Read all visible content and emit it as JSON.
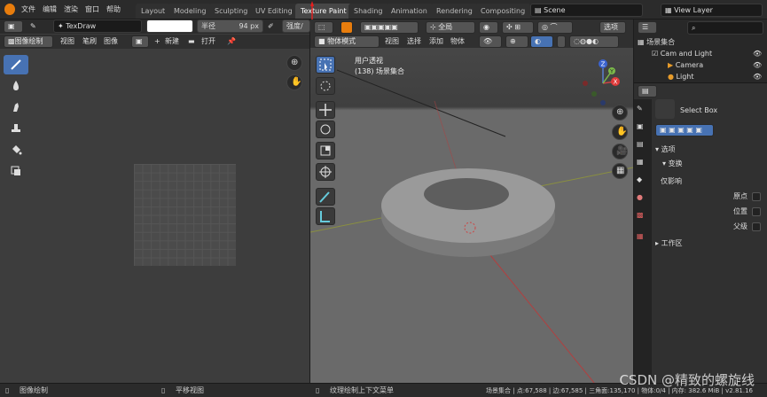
{
  "menu": [
    "文件",
    "编辑",
    "渲染",
    "窗口",
    "帮助"
  ],
  "workspaces": [
    "Layout",
    "Modeling",
    "Sculpting",
    "UV Editing",
    "Texture Paint",
    "Shading",
    "Animation",
    "Rendering",
    "Compositing"
  ],
  "active_workspace": "Texture Paint",
  "scene": "Scene",
  "view_layer": "View Layer",
  "brush": {
    "name": "TexDraw",
    "radius_label": "半径",
    "radius_value": "94 px",
    "strength_label": "强度/力"
  },
  "image_editor": {
    "mode": "图像绘制",
    "menu": [
      "视图",
      "笔刷",
      "图像"
    ],
    "new_label": "新建",
    "open_label": "打开"
  },
  "viewport": {
    "mode": "物体模式",
    "menu": [
      "视图",
      "选择",
      "添加",
      "物体"
    ],
    "orientation": "全局",
    "options": "选项",
    "overlay_title": "用户透视",
    "overlay_sub": "(138) 场景集合",
    "axis_x": "X",
    "axis_y": "Y",
    "axis_z": "Z"
  },
  "outliner": {
    "root": "场景集合",
    "collection": "Cam and Light",
    "items": [
      "Camera",
      "Light"
    ]
  },
  "properties": {
    "tool_name": "Select Box",
    "section_options": "选项",
    "section_transform": "变换",
    "affect_only": "仅影响",
    "opts": [
      "原点",
      "位置",
      "父级"
    ],
    "section_workspace": "工作区"
  },
  "status": {
    "left": "图像绘制",
    "mid": "平移视图",
    "context": "纹理绘制上下文菜单",
    "stats": "场景集合 | 点:67,588 | 边:67,585 | 三角面:135,170 | 物体:0/4 | 内存: 382.6 MiB | v2.81.16"
  },
  "watermark": "CSDN @精致的螺旋线",
  "colors": {
    "accent": "#4772b3",
    "warning": "#e81e1e",
    "logo": "#e87d0d"
  }
}
